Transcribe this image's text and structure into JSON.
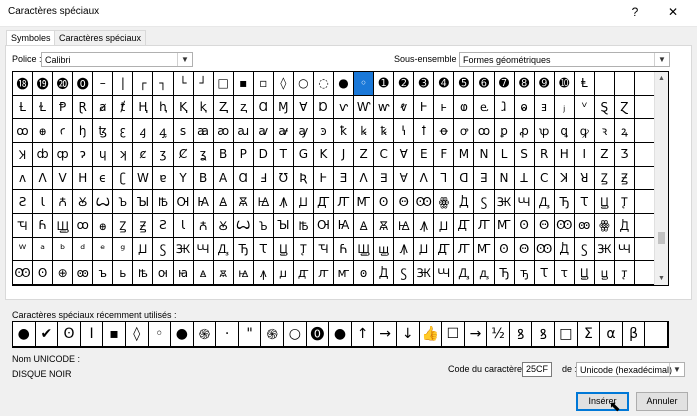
{
  "window": {
    "title": "Caractères spéciaux",
    "help": "?",
    "close": "✕"
  },
  "tabs": [
    {
      "label": "Symboles",
      "active": true
    },
    {
      "label": "Caractères spéciaux",
      "active": false
    }
  ],
  "font": {
    "label": "Police :",
    "value": "Calibri"
  },
  "subset": {
    "label": "Sous-ensemble :",
    "value": "Formes géométriques"
  },
  "grid": {
    "selected_index": 21,
    "rows": [
      [
        "⓲",
        "⓳",
        "⓴",
        "⓿",
        "–",
        "|",
        "┌",
        "┐",
        "└",
        "┘",
        "□",
        "▪",
        "▫",
        "◊",
        "○",
        "◌",
        "●",
        "◦",
        "➊",
        "➋",
        "➌",
        "➍",
        "➎",
        "➏",
        "➐",
        "➑",
        "➒",
        "➓",
        "Ⱡ",
        "",
        "",
        ""
      ],
      [
        "Ƚ",
        "Ɫ",
        "Ᵽ",
        "Ɽ",
        "ⱥ",
        "ⱦ",
        "Ⱨ",
        "ⱨ",
        "Ⱪ",
        "ⱪ",
        "Ⱬ",
        "ⱬ",
        "Ɑ",
        "Ɱ",
        "Ɐ",
        "Ɒ",
        "ⱱ",
        "Ⱳ",
        "ⱳ",
        "ⱴ",
        "Ⱶ",
        "ⱶ",
        "ⱷ",
        "ⱸ",
        "ⱹ",
        "ⱺ",
        "ⱻ",
        "ⱼ",
        "ⱽ",
        "Ȿ",
        "Ɀ",
        ""
      ],
      [
        "ꚙ",
        "ꚛ",
        "ꜥ",
        "ꜧ",
        "ꜩ",
        "ꜫ",
        "ꜭ",
        "ꜯ",
        "ꜱ",
        "ꜳ",
        "ꜵ",
        "ꜷ",
        "ꜹ",
        "ꜻ",
        "ꜽ",
        "ꜿ",
        "ꝁ",
        "ꝃ",
        "ꝅ",
        "ꝇ",
        "ꝉ",
        "ꝋ",
        "ꝍ",
        "ꝏ",
        "ꝑ",
        "ꝓ",
        "ꝕ",
        "ꝗ",
        "ꝙ",
        "ꝛ",
        "ꝝ",
        ""
      ],
      [
        "Ʞ",
        "ȸ",
        "ȹ",
        "ɂ",
        "ɥ",
        "ʞ",
        "ȼ",
        "ʒ",
        "Ȼ",
        "ʓ",
        "B",
        "P",
        "D",
        "T",
        "G",
        "K",
        "J",
        "Z",
        "C",
        "Ɐ",
        "E",
        "F",
        "M",
        "N",
        "L",
        "S",
        "R",
        "H",
        "I",
        "Z",
        "Ʒ",
        ""
      ],
      [
        "ʌ",
        "ꓥ",
        "V",
        "H",
        "ϵ",
        "ʗ",
        "W",
        "ɐ",
        "Y",
        "B",
        "A",
        "Ɑ",
        "Ⅎ",
        "Ʊ",
        "Ʀ",
        "Ⱶ",
        "Ǝ",
        "Ʌ",
        "∃",
        "ꓯ",
        "ꓥ",
        "ꓶ",
        "ꓷ",
        "ꓱ",
        "ꓠ",
        "ꓕ",
        "ꓚ",
        "ꓘ",
        "ꓤ",
        "Ꙁ",
        "Ꙃ",
        ""
      ],
      [
        "Ꙅ",
        "Ꙇ",
        "Ꙉ",
        "Ꙋ",
        "Ꙍ",
        "Ꙏ",
        "Ꙑ",
        "Ꙓ",
        "Ꙕ",
        "Ꙗ",
        "Ꙙ",
        "Ꙛ",
        "Ꙝ",
        "Ꙟ",
        "Ꙡ",
        "Ꙣ",
        "Ꙥ",
        "Ꙧ",
        "Ꙩ",
        "Ꙫ",
        "Ꙭ",
        "ꙮ",
        "Ꚁ",
        "Ꚃ",
        "Ꚅ",
        "Ꚇ",
        "Ꚉ",
        "Ꚋ",
        "Ꚍ",
        "Ꚏ",
        "Ꚑ",
        ""
      ],
      [
        "Ꚓ",
        "Ꚕ",
        "Ꚗ",
        "ꚙ",
        "ꚛ",
        "Ꙁ",
        "Ꙃ",
        "Ꙅ",
        "Ꙇ",
        "Ꙉ",
        "Ꙋ",
        "Ꙍ",
        "Ꙏ",
        "Ꙑ",
        "Ꙓ",
        "Ꙕ",
        "Ꙗ",
        "Ꙙ",
        "Ꙛ",
        "Ꙝ",
        "Ꙟ",
        "Ꙡ",
        "Ꙣ",
        "Ꙥ",
        "Ꙧ",
        "Ꙩ",
        "Ꙫ",
        "Ꙭ",
        "ꙭ",
        "ꙮ",
        "Ꚁ",
        ""
      ],
      [
        "ᵂ",
        "ᵃ",
        "ᵇ",
        "ᵈ",
        "ᵉ",
        "ᵍ",
        "Ꙡ",
        "Ꚃ",
        "Ꚅ",
        "Ꚇ",
        "Ꚉ",
        "Ꚋ",
        "Ꚍ",
        "Ꚏ",
        "Ꚑ",
        "Ꚓ",
        "Ꚕ",
        "Ꚗ",
        "ꚗ",
        "Ꙟ",
        "Ꙡ",
        "Ꙣ",
        "Ꙥ",
        "Ꙧ",
        "Ꙩ",
        "Ꙫ",
        "Ꙭ",
        "Ꚁ",
        "Ꚃ",
        "Ꚅ",
        "Ꚇ",
        ""
      ],
      [
        "Ꙭ",
        "Ꙩ",
        "⊕",
        "ꙭ",
        "ъ",
        "ь",
        "ꙓ",
        "ꙕ",
        "ꙗ",
        "ꙙ",
        "ꙛ",
        "ꙝ",
        "ꙟ",
        "ꙡ",
        "ꙣ",
        "ꙥ",
        "ꙧ",
        "ꙩ",
        "Ꚁ",
        "Ꚃ",
        "Ꚅ",
        "Ꚇ",
        "Ꚉ",
        "ꚉ",
        "Ꚋ",
        "ꚋ",
        "Ꚍ",
        "ꚍ",
        "Ꚏ",
        "ꚏ",
        "ꚑ",
        ""
      ]
    ]
  },
  "recent": {
    "label": "Caractères spéciaux récemment utilisés :",
    "symbols": [
      "●",
      "✔",
      "ʘ",
      "Ⅰ",
      "▪",
      "◊",
      "◦",
      "●",
      "֍",
      "·",
      "\"",
      "֍",
      "○",
      "⓿",
      "●",
      "↑",
      "→",
      "↓",
      "👍",
      "☐",
      "→",
      "½",
      "ꝸ",
      "ꝸ",
      "□",
      "Σ",
      "α",
      "β",
      ""
    ]
  },
  "unicode": {
    "name_label": "Nom UNICODE :",
    "name_value": "DISQUE NOIR"
  },
  "code": {
    "label": "Code du caractère :",
    "value": "25CF",
    "from_label": "de :",
    "from_value": "Unicode (hexadécimal)"
  },
  "buttons": {
    "insert": "Insérer",
    "cancel": "Annuler"
  }
}
